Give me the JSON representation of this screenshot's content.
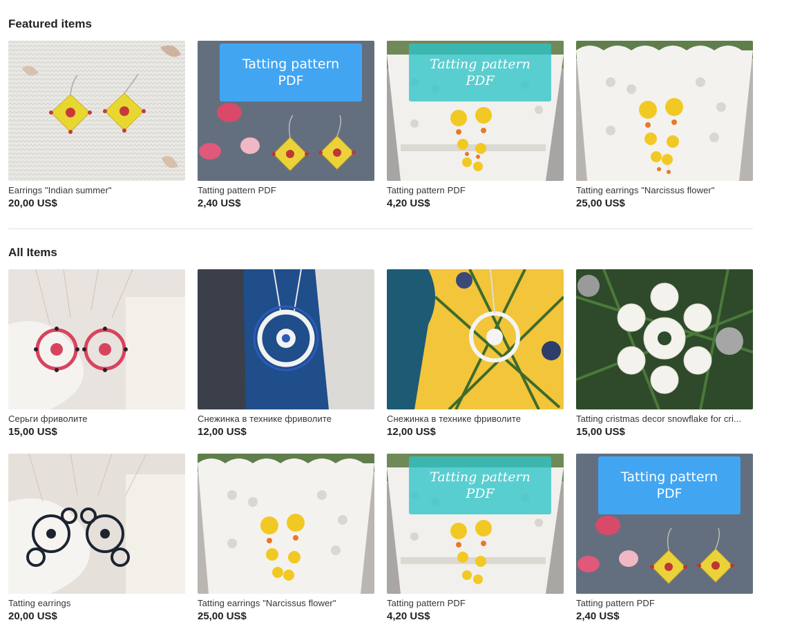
{
  "featured": {
    "title": "Featured items",
    "items": [
      {
        "title": "Earrings \"Indian summer\"",
        "price": "20,00 US$",
        "image": "yellow-diamond-earrings-on-white-knit",
        "badge": ""
      },
      {
        "title": "Tatting pattern PDF",
        "price": "2,40 US$",
        "image": "yellow-diamond-earrings-on-denim-with-rose-petals",
        "badge": "Tatting pattern PDF"
      },
      {
        "title": "Tatting pattern PDF",
        "price": "4,20 US$",
        "image": "yellow-flower-earrings-on-white-lace-pot",
        "badge": "Tatting pattern PDF"
      },
      {
        "title": "Tatting earrings \"Narcissus flower\"",
        "price": "25,00 US$",
        "image": "yellow-flower-earrings-on-white-lace-pot",
        "badge": ""
      }
    ]
  },
  "all": {
    "title": "All Items",
    "items": [
      {
        "title": "Серьги фриволите",
        "price": "15,00 US$",
        "image": "red-round-earrings-on-white-fabric",
        "badge": ""
      },
      {
        "title": "Снежинка в технике фриволите",
        "price": "12,00 US$",
        "image": "blue-white-snowflake-pendant-on-blue-wood",
        "badge": ""
      },
      {
        "title": "Снежинка в технике фриволите",
        "price": "12,00 US$",
        "image": "white-snowflake-on-christmas-tree",
        "badge": ""
      },
      {
        "title": "Tatting cristmas decor snowflake for cri...",
        "price": "15,00 US$",
        "image": "white-lace-snowflake-on-fir-branches",
        "badge": ""
      },
      {
        "title": "Tatting earrings",
        "price": "20,00 US$",
        "image": "black-lace-earrings-on-white-fabric",
        "badge": ""
      },
      {
        "title": "Tatting earrings \"Narcissus flower\"",
        "price": "25,00 US$",
        "image": "yellow-flower-earrings-on-white-lace-pot",
        "badge": ""
      },
      {
        "title": "Tatting pattern PDF",
        "price": "4,20 US$",
        "image": "yellow-flower-earrings-on-white-lace-pot",
        "badge": "Tatting pattern PDF"
      },
      {
        "title": "Tatting pattern PDF",
        "price": "2,40 US$",
        "image": "yellow-diamond-earrings-on-denim-with-rose-petals",
        "badge": "Tatting pattern PDF"
      }
    ]
  },
  "colors": {
    "badge_blue": "#41a5f2",
    "badge_teal": "#2ec4c8",
    "divider": "#e1e1e1",
    "text": "#222222"
  }
}
